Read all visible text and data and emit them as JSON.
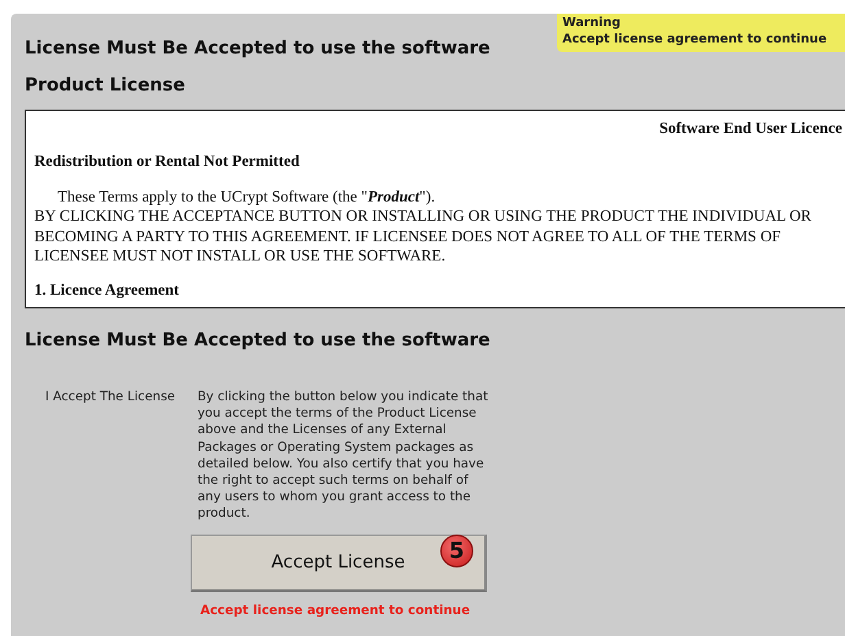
{
  "warning": {
    "title": "Warning",
    "message": "Accept license agreement to continue"
  },
  "heading": "License Must Be Accepted to use the software",
  "license_title": "Product License",
  "license_text": {
    "doc_title": "Software End User Licence",
    "section_1": "Redistribution or Rental Not Permitted",
    "intro": "These Terms apply to the UCrypt Software (the \"*Product*\").",
    "caps_lines": [
      "BY CLICKING THE ACCEPTANCE BUTTON OR INSTALLING OR USING THE PRODUCT THE INDIVIDUAL OR",
      "BECOMING A PARTY TO THIS AGREEMENT. IF LICENSEE DOES NOT AGREE TO ALL OF THE TERMS OF",
      "LICENSEE MUST NOT INSTALL OR USE THE SOFTWARE."
    ],
    "section_2": "1. Licence Agreement"
  },
  "accept_heading": "License Must Be Accepted to use the software",
  "accept_label": "I Accept The License",
  "accept_description": "By clicking the button below you indicate that you accept the terms of the Product License above and the Licenses of any External Packages or Operating System packages as detailed below. You also certify that you have the right to accept such terms on behalf of any users to whom you grant access to the product.",
  "accept_button": "Accept License",
  "step_badge": "5",
  "error": "Accept license agreement to continue"
}
